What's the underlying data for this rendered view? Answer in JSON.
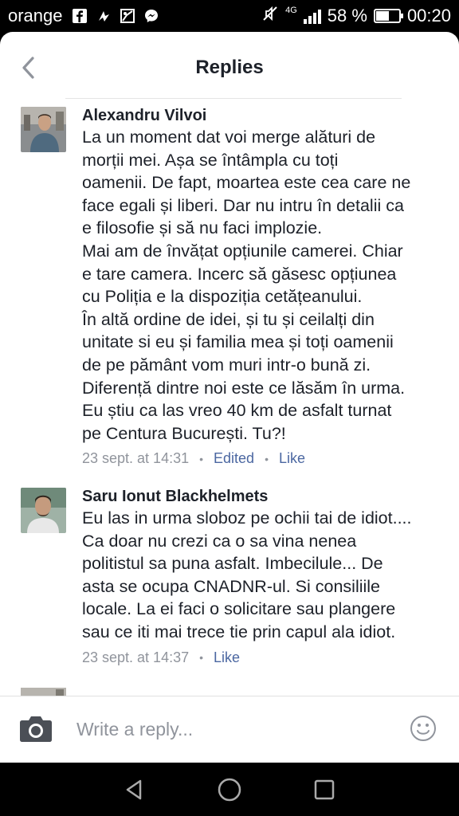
{
  "status_bar": {
    "carrier": "orange",
    "network": "4G",
    "battery": "58 %",
    "battery_level": 0.58,
    "time": "00:20",
    "icons": [
      "facebook-icon",
      "notification-icon",
      "gallery-icon",
      "messenger-icon",
      "mute-icon",
      "signal-icon",
      "battery-icon"
    ]
  },
  "header": {
    "title": "Replies",
    "back_icon": "chevron-left-icon"
  },
  "comments": [
    {
      "author": "Alexandru Vilvoi",
      "text": "La un moment dat voi merge alături de\nmorții mei. Așa se întâmpla cu toți\noamenii. De fapt, moartea este cea care ne\nface egali și liberi. Dar nu intru în detalii ca\ne filosofie și să nu faci implozie.\nMai am de învățat opțiunile camerei. Chiar\ne tare camera. Incerc să găsesc opțiunea\ncu Poliția e la dispoziția cetățeanului.\nÎn altă ordine de idei, și tu și ceilalți din\nunitate si eu și familia mea și toți oamenii\nde pe pământ vom muri intr-o bună zi.\nDiferență dintre noi este ce lăsăm în urma.\nEu știu ca las vreo 40 km de asfalt turnat\npe Centura București. Tu?!",
      "timestamp": "23 sept. at 14:31",
      "edited": "Edited",
      "like": "Like"
    },
    {
      "author": "Saru Ionut Blackhelmets",
      "text": "Eu las in urma sloboz pe ochii tai de idiot....\nCa doar nu crezi ca o sa vina nenea\npolitistul sa puna asfalt. Imbecilule... De\nasta se ocupa CNADNR-ul. Si consiliile\nlocale. La ei faci o solicitare sau plangere\nsau ce iti mai trece tie prin capul ala idiot.",
      "timestamp": "23 sept. at 14:37",
      "like": "Like"
    }
  ],
  "reply_bar": {
    "placeholder": "Write a reply...",
    "camera_icon": "camera-icon",
    "emoji_icon": "smiley-icon"
  },
  "nav_bar": {
    "icons": [
      "back-triangle-icon",
      "home-circle-icon",
      "recents-square-icon"
    ]
  },
  "colors": {
    "link": "#4b67a1",
    "meta": "#90949c",
    "text": "#1d2129"
  }
}
